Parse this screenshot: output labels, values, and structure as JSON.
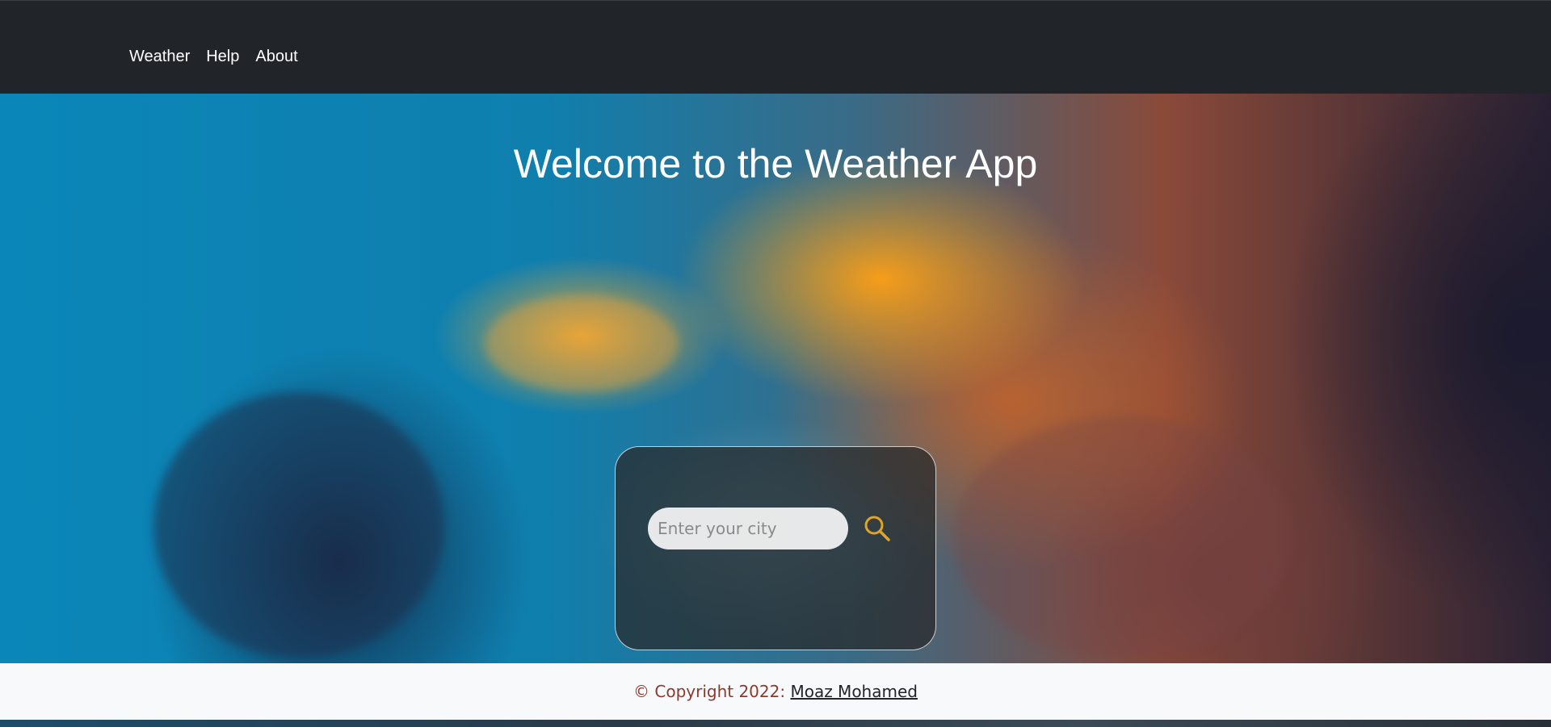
{
  "nav": {
    "items": [
      {
        "label": "Weather"
      },
      {
        "label": "Help"
      },
      {
        "label": "About"
      }
    ]
  },
  "hero": {
    "title": "Welcome to the Weather App"
  },
  "search": {
    "placeholder": "Enter your city",
    "value": "",
    "icon": "search-icon",
    "icon_color": "#e0a526"
  },
  "footer": {
    "copyright": "© Copyright 2022: ",
    "author": "Moaz Mohamed"
  },
  "colors": {
    "navbar_bg": "#212529",
    "footer_bg": "#f8f9fa",
    "copyright_text": "#8b3a2e"
  }
}
